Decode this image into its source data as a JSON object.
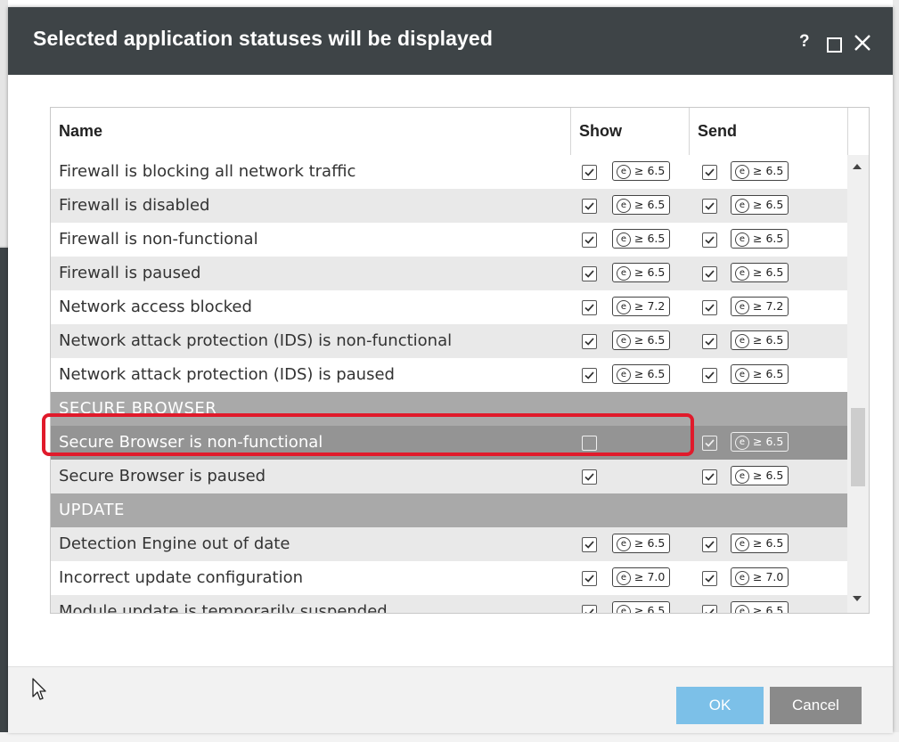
{
  "dialog": {
    "title": "Selected application statuses will be displayed",
    "controls": {
      "help": "?"
    }
  },
  "table": {
    "columns": {
      "name": "Name",
      "show": "Show",
      "send": "Send"
    },
    "rows": [
      {
        "type": "item",
        "name": "Firewall is blocking all network traffic",
        "show": true,
        "show_badge": "≥ 6.5",
        "send": true,
        "send_badge": "≥ 6.5"
      },
      {
        "type": "item",
        "name": "Firewall is disabled",
        "show": true,
        "show_badge": "≥ 6.5",
        "send": true,
        "send_badge": "≥ 6.5"
      },
      {
        "type": "item",
        "name": "Firewall is non-functional",
        "show": true,
        "show_badge": "≥ 6.5",
        "send": true,
        "send_badge": "≥ 6.5"
      },
      {
        "type": "item",
        "name": "Firewall is paused",
        "show": true,
        "show_badge": "≥ 6.5",
        "send": true,
        "send_badge": "≥ 6.5"
      },
      {
        "type": "item",
        "name": "Network access blocked",
        "show": true,
        "show_badge": "≥ 7.2",
        "send": true,
        "send_badge": "≥ 7.2"
      },
      {
        "type": "item",
        "name": "Network attack protection (IDS) is non-functional",
        "show": true,
        "show_badge": "≥ 6.5",
        "send": true,
        "send_badge": "≥ 6.5"
      },
      {
        "type": "item",
        "name": "Network attack protection (IDS) is paused",
        "show": true,
        "show_badge": "≥ 6.5",
        "send": true,
        "send_badge": "≥ 6.5"
      },
      {
        "type": "section",
        "name": "SECURE BROWSER"
      },
      {
        "type": "item",
        "name": "Secure Browser is non-functional",
        "show": false,
        "show_badge": "",
        "send": true,
        "send_badge": "≥ 6.5",
        "selected": true
      },
      {
        "type": "item",
        "name": "Secure Browser is paused",
        "show": true,
        "show_badge": "",
        "send": true,
        "send_badge": "≥ 6.5"
      },
      {
        "type": "section",
        "name": "UPDATE"
      },
      {
        "type": "item",
        "name": "Detection Engine out of date",
        "show": true,
        "show_badge": "≥ 6.5",
        "send": true,
        "send_badge": "≥ 6.5"
      },
      {
        "type": "item",
        "name": "Incorrect update configuration",
        "show": true,
        "show_badge": "≥ 7.0",
        "send": true,
        "send_badge": "≥ 7.0"
      },
      {
        "type": "item",
        "name": "Module update is temporarily suspended",
        "show": true,
        "show_badge": "≥ 6.5",
        "send": true,
        "send_badge": "≥ 6.5"
      }
    ]
  },
  "buttons": {
    "ok": "OK",
    "cancel": "Cancel"
  },
  "colors": {
    "title_bar": "#3e4447",
    "section_row": "#a9a9a9",
    "selected_row": "#949494",
    "highlight_box": "#e01a2b",
    "ok_button": "#7cc0e8",
    "cancel_button": "#8a8a8a"
  },
  "icons": {
    "badge": "eset-e-icon",
    "close": "close-icon",
    "maximize": "maximize-icon",
    "help": "help-icon"
  }
}
